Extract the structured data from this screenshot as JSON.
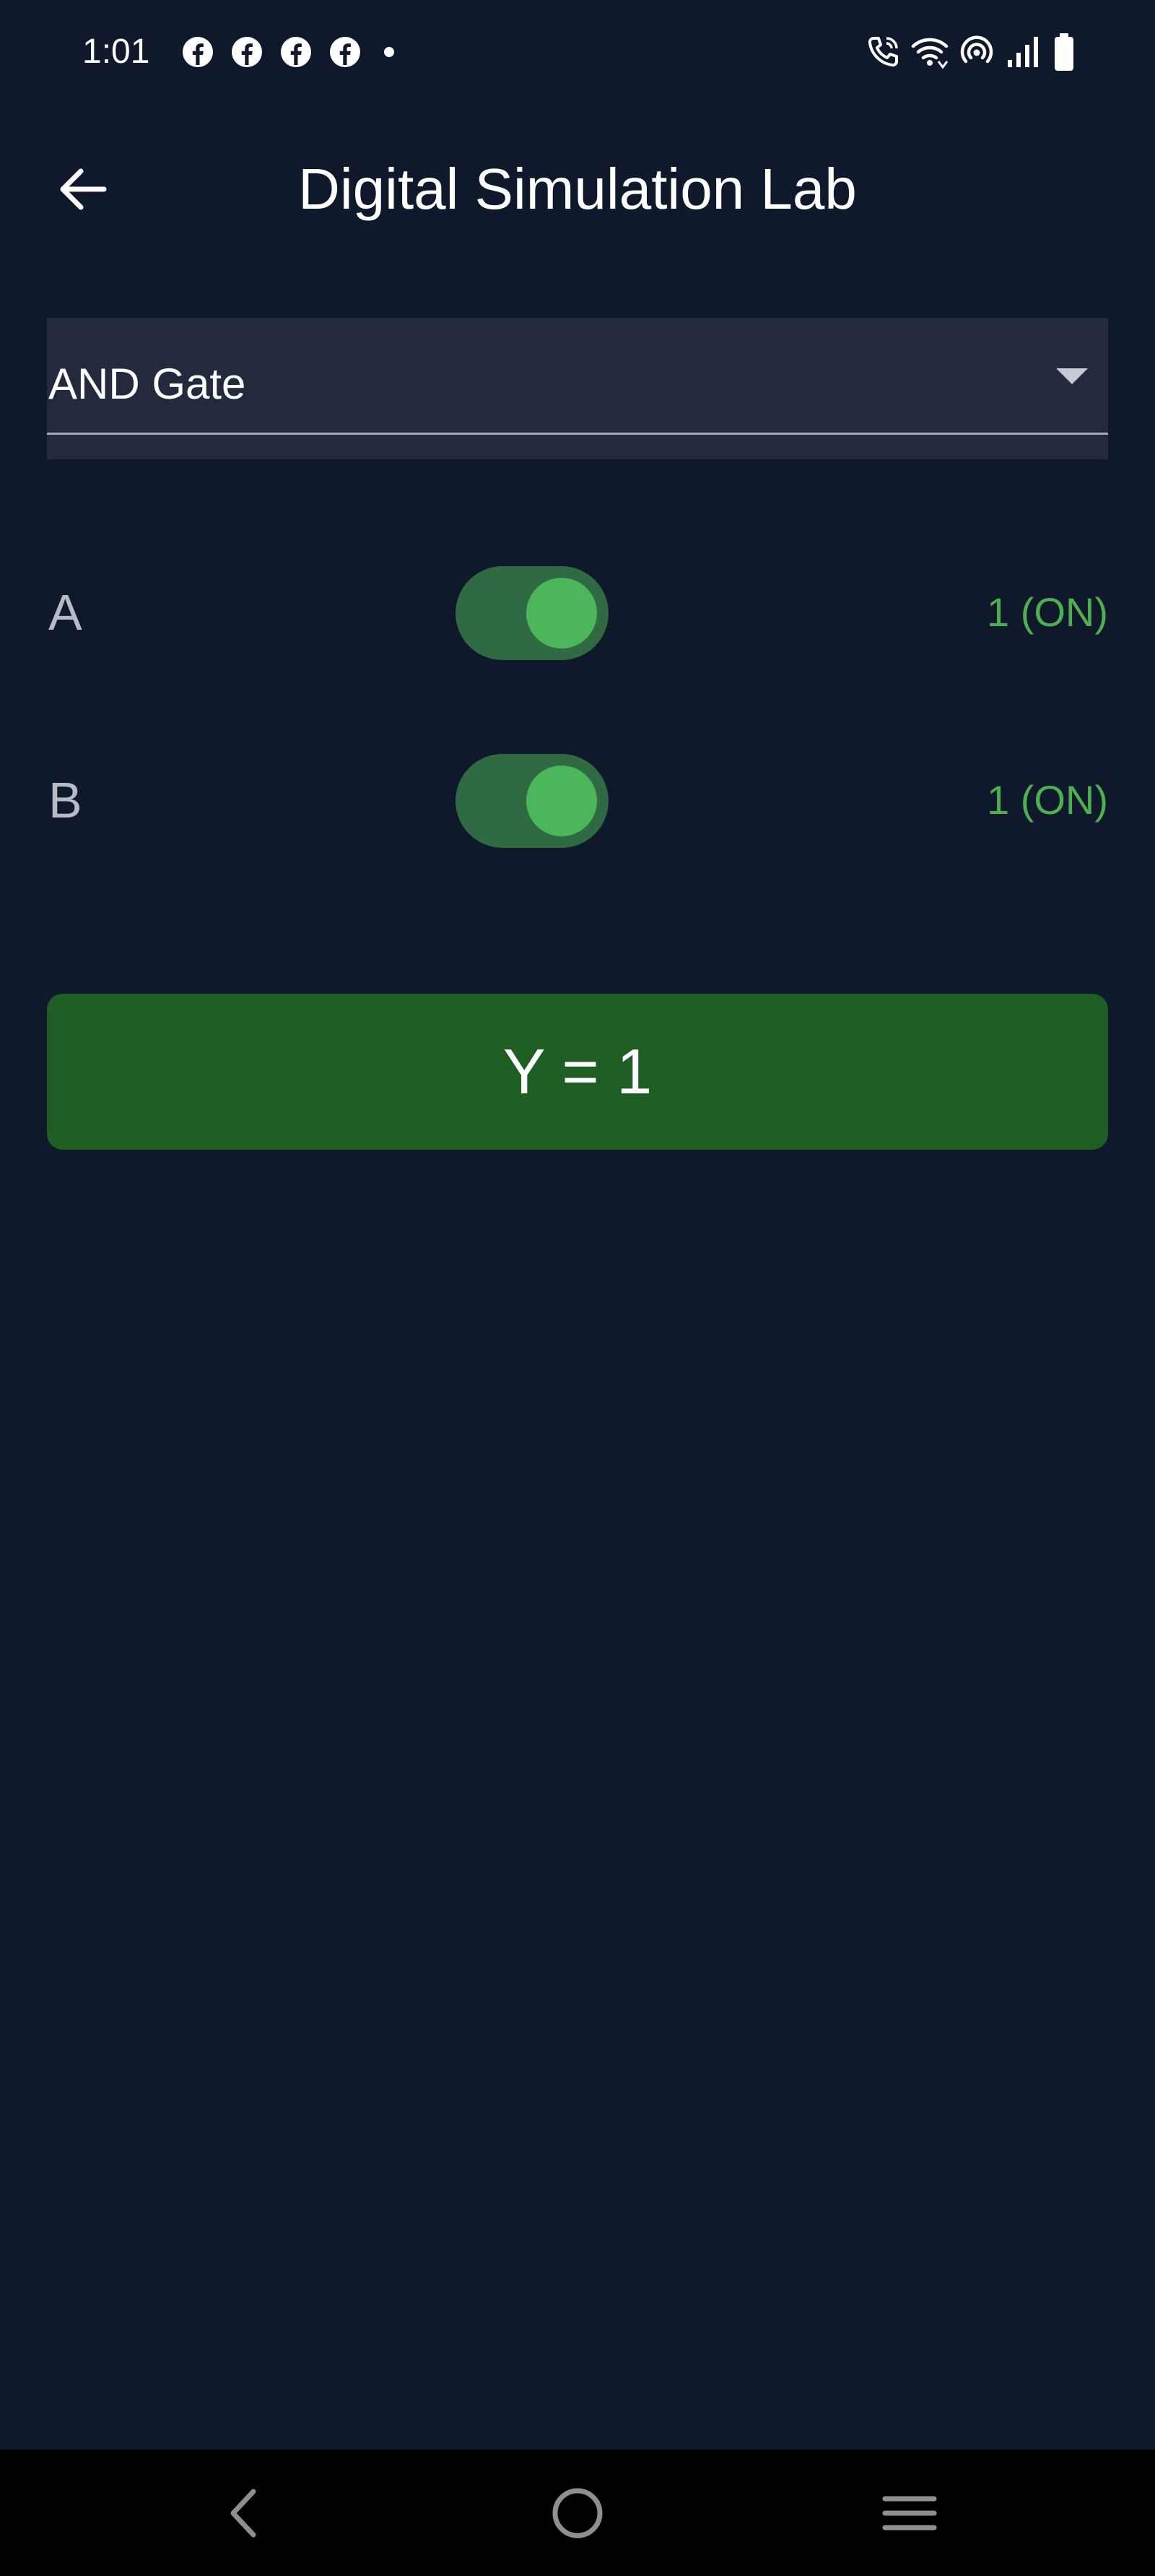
{
  "status_bar": {
    "time": "1:01",
    "notification_icons": [
      "facebook-icon",
      "facebook-icon",
      "facebook-icon",
      "facebook-icon",
      "more-dot-icon"
    ],
    "system_icons": [
      "wifi-calling-icon",
      "wifi-icon",
      "hotspot-icon",
      "signal-icon",
      "battery-icon"
    ]
  },
  "app_bar": {
    "title": "Digital Simulation Lab",
    "back_icon": "arrow-left-icon"
  },
  "gate_select": {
    "selected": "AND Gate",
    "icon": "dropdown-arrow-icon"
  },
  "inputs": [
    {
      "label": "A",
      "on": true,
      "state": "1 (ON)"
    },
    {
      "label": "B",
      "on": true,
      "state": "1 (ON)"
    }
  ],
  "output": {
    "text": "Y = 1"
  },
  "colors": {
    "background": "#10182b",
    "dropdown_background": "#232a3e",
    "toggle_track_on": "#2f6a42",
    "toggle_knob_on": "#4cb65a",
    "state_text_on": "#4caf50",
    "output_background": "#1f5e23"
  },
  "nav_bar": {
    "icons": [
      "nav-back-icon",
      "nav-home-icon",
      "nav-recents-icon"
    ]
  }
}
